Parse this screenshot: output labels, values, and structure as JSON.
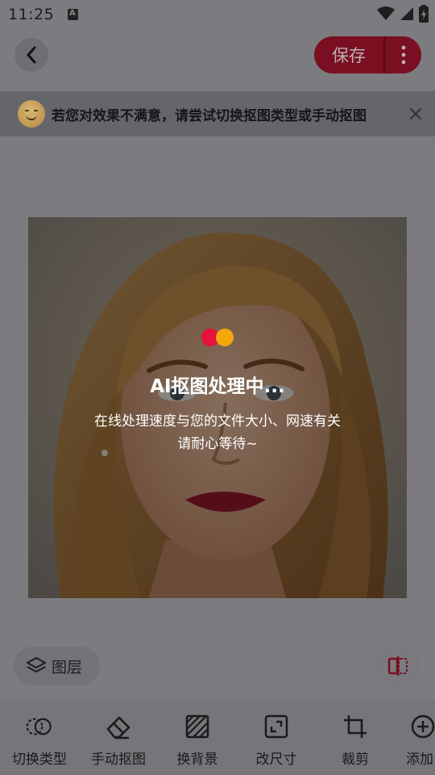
{
  "status": {
    "time": "11:25"
  },
  "header": {
    "save_label": "保存"
  },
  "tip": {
    "text": "若您对效果不满意，请尝试切换抠图类型或手动抠图"
  },
  "processing": {
    "title": "AI抠图处理中...",
    "line1": "在线处理速度与您的文件大小、网速有关",
    "line2": "请耐心等待~"
  },
  "layer_button": {
    "label": "图层"
  },
  "toolbar": {
    "items": [
      {
        "label": "切换类型",
        "icon": "switch-type-icon"
      },
      {
        "label": "手动抠图",
        "icon": "eraser-icon"
      },
      {
        "label": "换背景",
        "icon": "background-icon"
      },
      {
        "label": "改尺寸",
        "icon": "resize-icon"
      },
      {
        "label": "裁剪",
        "icon": "crop-icon"
      },
      {
        "label": "添加",
        "icon": "add-icon"
      }
    ]
  },
  "colors": {
    "brand": "#e6133c",
    "accent_yellow": "#f5a70a"
  }
}
